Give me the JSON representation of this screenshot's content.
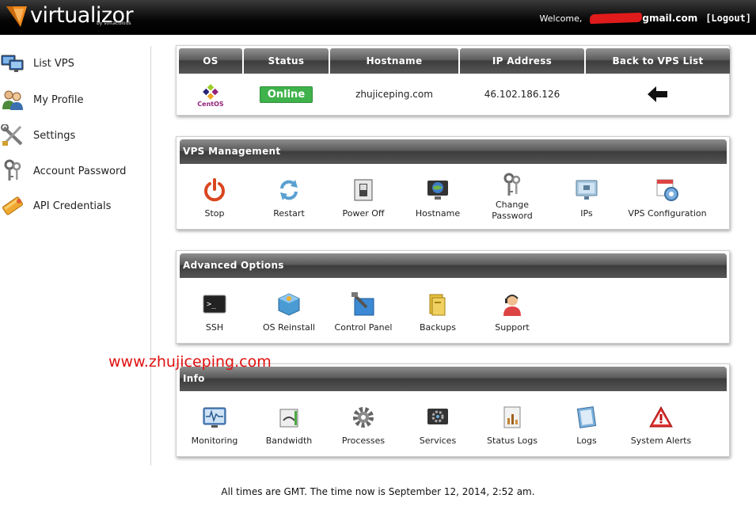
{
  "header": {
    "brand": "virtualizor",
    "brand_sub": "by softaculous",
    "welcome_label": "Welcome,",
    "email_suffix": "gmail.com",
    "logout": "[Logout]"
  },
  "sidebar": {
    "items": [
      {
        "label": "List VPS",
        "icon": "monitors-icon"
      },
      {
        "label": "My Profile",
        "icon": "users-icon"
      },
      {
        "label": "Settings",
        "icon": "tools-icon"
      },
      {
        "label": "Account Password",
        "icon": "keys-icon"
      },
      {
        "label": "API Credentials",
        "icon": "api-icon"
      }
    ]
  },
  "vps_table": {
    "headers": [
      "OS",
      "Status",
      "Hostname",
      "IP Address",
      "Back to VPS List"
    ],
    "row": {
      "os": "CentOS",
      "status": "Online",
      "hostname": "zhujiceping.com",
      "ip": "46.102.186.126"
    }
  },
  "vps_management": {
    "title": "VPS Management",
    "tools": [
      {
        "label": "Stop",
        "icon": "power-icon"
      },
      {
        "label": "Restart",
        "icon": "refresh-icon"
      },
      {
        "label": "Power Off",
        "icon": "switch-icon"
      },
      {
        "label": "Hostname",
        "icon": "globe-monitor-icon"
      },
      {
        "label": "Change Password",
        "icon": "keys-icon"
      },
      {
        "label": "IPs",
        "icon": "network-monitor-icon"
      },
      {
        "label": "VPS Configuration",
        "icon": "config-icon"
      }
    ]
  },
  "advanced_options": {
    "title": "Advanced Options",
    "tools": [
      {
        "label": "SSH",
        "icon": "terminal-icon"
      },
      {
        "label": "OS Reinstall",
        "icon": "package-icon"
      },
      {
        "label": "Control Panel",
        "icon": "control-panel-icon"
      },
      {
        "label": "Backups",
        "icon": "backup-icon"
      },
      {
        "label": "Support",
        "icon": "support-icon"
      }
    ]
  },
  "info": {
    "title": "Info",
    "tools": [
      {
        "label": "Monitoring",
        "icon": "monitor-graph-icon"
      },
      {
        "label": "Bandwidth",
        "icon": "bandwidth-icon"
      },
      {
        "label": "Processes",
        "icon": "gear-icon"
      },
      {
        "label": "Services",
        "icon": "services-icon"
      },
      {
        "label": "Status Logs",
        "icon": "status-logs-icon"
      },
      {
        "label": "Logs",
        "icon": "logs-icon"
      },
      {
        "label": "System Alerts",
        "icon": "alert-icon"
      }
    ]
  },
  "watermark": "www.zhujiceping.com",
  "footer": "All times are GMT. The time now is September 12, 2014, 2:52 am.",
  "colors": {
    "online_green": "#3fb24b",
    "header_black": "#000000",
    "watermark_red": "#e01010",
    "logo_orange": "#f08a1c"
  }
}
